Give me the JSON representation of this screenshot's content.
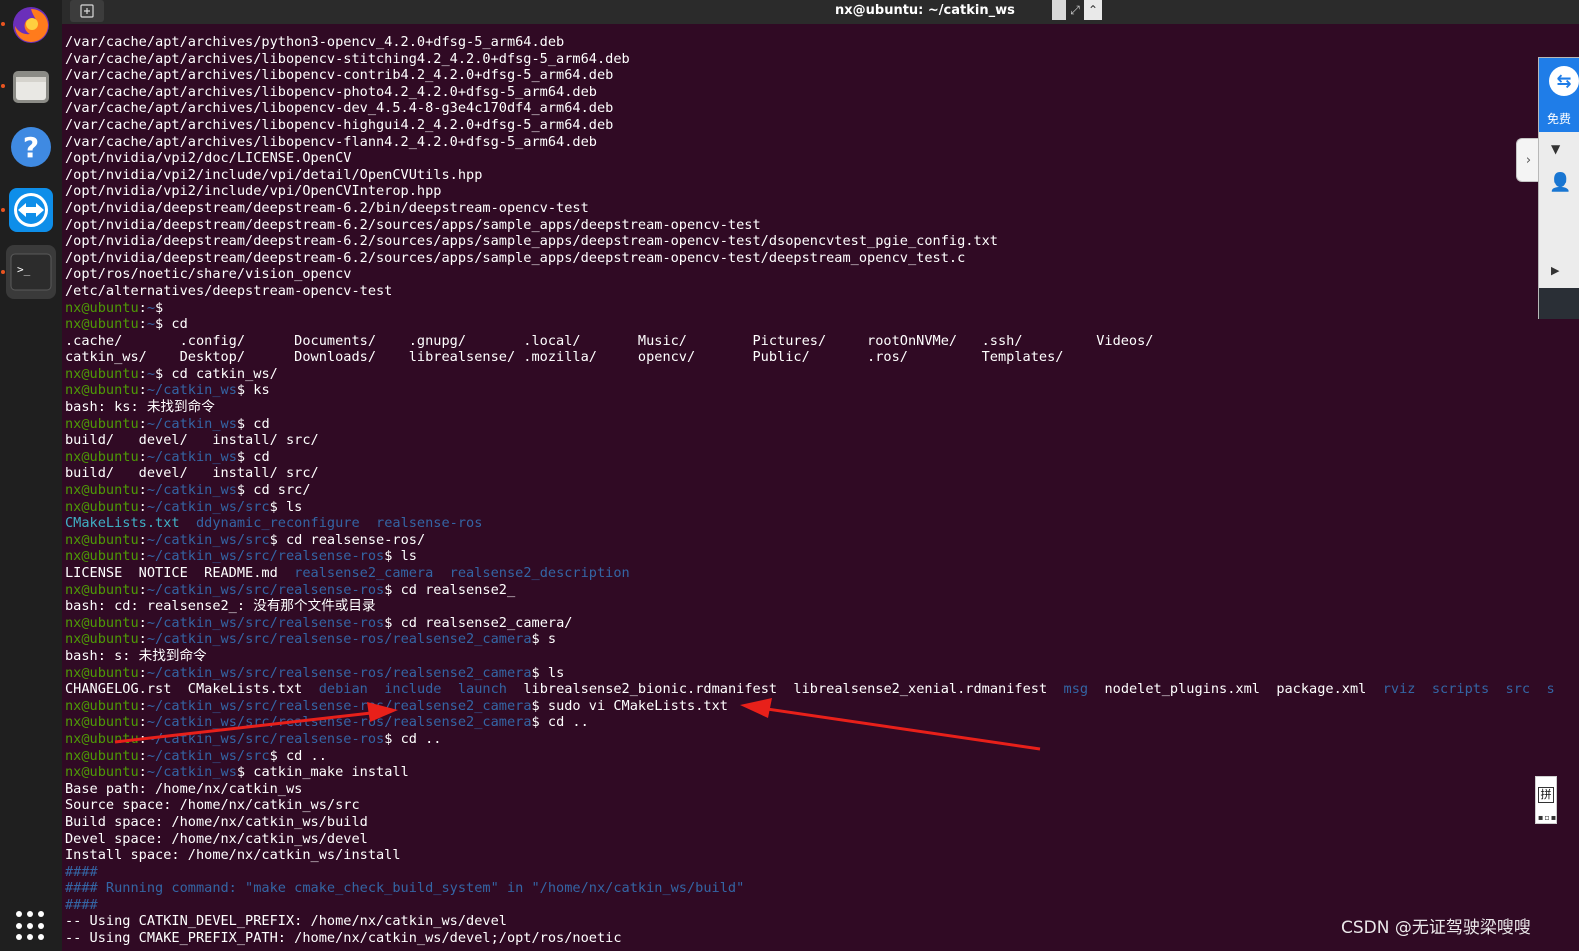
{
  "window": {
    "title": "nx@ubuntu: ~/catkin_ws",
    "new_tab_icon": "plus-square-icon"
  },
  "dock": {
    "items": [
      {
        "name": "firefox",
        "icon": "firefox-icon",
        "running": true
      },
      {
        "name": "files",
        "icon": "folder-icon",
        "running": true
      },
      {
        "name": "help",
        "icon": "help-icon",
        "glyph": "?",
        "running": false
      },
      {
        "name": "teamviewer",
        "icon": "teamviewer-icon",
        "running": true
      },
      {
        "name": "terminal",
        "icon": "terminal-icon",
        "glyph": ">_",
        "running": true
      }
    ],
    "show_apps_icon": "apps-grid-icon"
  },
  "terminal": {
    "colors": {
      "background": "#300a24",
      "prompt_user": "#4e9a06",
      "prompt_path": "#3465a4",
      "text": "#ffffff"
    },
    "lines": [
      [
        {
          "t": "/var/cache/apt/archives/python3-opencv_4.2.0+dfsg-5_arm64.deb"
        }
      ],
      [
        {
          "t": "/var/cache/apt/archives/libopencv-stitching4.2_4.2.0+dfsg-5_arm64.deb"
        }
      ],
      [
        {
          "t": "/var/cache/apt/archives/libopencv-contrib4.2_4.2.0+dfsg-5_arm64.deb"
        }
      ],
      [
        {
          "t": "/var/cache/apt/archives/libopencv-photo4.2_4.2.0+dfsg-5_arm64.deb"
        }
      ],
      [
        {
          "t": "/var/cache/apt/archives/libopencv-dev_4.5.4-8-g3e4c170df4_arm64.deb"
        }
      ],
      [
        {
          "t": "/var/cache/apt/archives/libopencv-highgui4.2_4.2.0+dfsg-5_arm64.deb"
        }
      ],
      [
        {
          "t": "/var/cache/apt/archives/libopencv-flann4.2_4.2.0+dfsg-5_arm64.deb"
        }
      ],
      [
        {
          "t": "/opt/nvidia/vpi2/doc/LICENSE.OpenCV"
        }
      ],
      [
        {
          "t": "/opt/nvidia/vpi2/include/vpi/detail/OpenCVUtils.hpp"
        }
      ],
      [
        {
          "t": "/opt/nvidia/vpi2/include/vpi/OpenCVInterop.hpp"
        }
      ],
      [
        {
          "t": "/opt/nvidia/deepstream/deepstream-6.2/bin/deepstream-opencv-test"
        }
      ],
      [
        {
          "t": "/opt/nvidia/deepstream/deepstream-6.2/sources/apps/sample_apps/deepstream-opencv-test"
        }
      ],
      [
        {
          "t": "/opt/nvidia/deepstream/deepstream-6.2/sources/apps/sample_apps/deepstream-opencv-test/dsopencvtest_pgie_config.txt"
        }
      ],
      [
        {
          "t": "/opt/nvidia/deepstream/deepstream-6.2/sources/apps/sample_apps/deepstream-opencv-test/deepstream_opencv_test.c"
        }
      ],
      [
        {
          "t": "/opt/ros/noetic/share/vision_opencv"
        }
      ],
      [
        {
          "t": "/etc/alternatives/deepstream-opencv-test"
        }
      ],
      [
        {
          "t": "nx@ubuntu",
          "c": "g"
        },
        {
          "t": ":"
        },
        {
          "t": "~",
          "c": "b"
        },
        {
          "t": "$"
        }
      ],
      [
        {
          "t": "nx@ubuntu",
          "c": "g"
        },
        {
          "t": ":"
        },
        {
          "t": "~",
          "c": "b"
        },
        {
          "t": "$ cd"
        }
      ],
      [
        {
          "t": ".cache/       .config/      Documents/    .gnupg/       .local/       Music/        Pictures/     rootOnNVMe/   .ssh/         Videos/"
        }
      ],
      [
        {
          "t": "catkin_ws/    Desktop/      Downloads/    librealsense/ .mozilla/     opencv/       Public/       .ros/         Templates/"
        }
      ],
      [
        {
          "t": "nx@ubuntu",
          "c": "g"
        },
        {
          "t": ":"
        },
        {
          "t": "~",
          "c": "b"
        },
        {
          "t": "$ cd catkin_ws/"
        }
      ],
      [
        {
          "t": "nx@ubuntu",
          "c": "g"
        },
        {
          "t": ":"
        },
        {
          "t": "~/catkin_ws",
          "c": "b"
        },
        {
          "t": "$ ks"
        }
      ],
      [
        {
          "t": "bash: ks: 未找到命令"
        }
      ],
      [
        {
          "t": "nx@ubuntu",
          "c": "g"
        },
        {
          "t": ":"
        },
        {
          "t": "~/catkin_ws",
          "c": "b"
        },
        {
          "t": "$ cd"
        }
      ],
      [
        {
          "t": "build/   devel/   install/ src/"
        }
      ],
      [
        {
          "t": "nx@ubuntu",
          "c": "g"
        },
        {
          "t": ":"
        },
        {
          "t": "~/catkin_ws",
          "c": "b"
        },
        {
          "t": "$ cd"
        }
      ],
      [
        {
          "t": "build/   devel/   install/ src/"
        }
      ],
      [
        {
          "t": "nx@ubuntu",
          "c": "g"
        },
        {
          "t": ":"
        },
        {
          "t": "~/catkin_ws",
          "c": "b"
        },
        {
          "t": "$ cd src/"
        }
      ],
      [
        {
          "t": "nx@ubuntu",
          "c": "g"
        },
        {
          "t": ":"
        },
        {
          "t": "~/catkin_ws/src",
          "c": "b"
        },
        {
          "t": "$ ls"
        }
      ],
      [
        {
          "t": "CMakeLists.txt",
          "c": "c"
        },
        {
          "t": "  "
        },
        {
          "t": "ddynamic_reconfigure",
          "c": "b"
        },
        {
          "t": "  "
        },
        {
          "t": "realsense-ros",
          "c": "b"
        }
      ],
      [
        {
          "t": "nx@ubuntu",
          "c": "g"
        },
        {
          "t": ":"
        },
        {
          "t": "~/catkin_ws/src",
          "c": "b"
        },
        {
          "t": "$ cd realsense-ros/"
        }
      ],
      [
        {
          "t": "nx@ubuntu",
          "c": "g"
        },
        {
          "t": ":"
        },
        {
          "t": "~/catkin_ws/src/realsense-ros",
          "c": "b"
        },
        {
          "t": "$ ls"
        }
      ],
      [
        {
          "t": "LICENSE  NOTICE  README.md  "
        },
        {
          "t": "realsense2_camera",
          "c": "b"
        },
        {
          "t": "  "
        },
        {
          "t": "realsense2_description",
          "c": "b"
        }
      ],
      [
        {
          "t": "nx@ubuntu",
          "c": "g"
        },
        {
          "t": ":"
        },
        {
          "t": "~/catkin_ws/src/realsense-ros",
          "c": "b"
        },
        {
          "t": "$ cd realsense2_"
        }
      ],
      [
        {
          "t": "bash: cd: realsense2_: 没有那个文件或目录"
        }
      ],
      [
        {
          "t": "nx@ubuntu",
          "c": "g"
        },
        {
          "t": ":"
        },
        {
          "t": "~/catkin_ws/src/realsense-ros",
          "c": "b"
        },
        {
          "t": "$ cd realsense2_camera/"
        }
      ],
      [
        {
          "t": "nx@ubuntu",
          "c": "g"
        },
        {
          "t": ":"
        },
        {
          "t": "~/catkin_ws/src/realsense-ros/realsense2_camera",
          "c": "b"
        },
        {
          "t": "$ s"
        }
      ],
      [
        {
          "t": "bash: s: 未找到命令"
        }
      ],
      [
        {
          "t": "nx@ubuntu",
          "c": "g"
        },
        {
          "t": ":"
        },
        {
          "t": "~/catkin_ws/src/realsense-ros/realsense2_camera",
          "c": "b"
        },
        {
          "t": "$ ls"
        }
      ],
      [
        {
          "t": "CHANGELOG.rst  CMakeLists.txt  "
        },
        {
          "t": "debian",
          "c": "b"
        },
        {
          "t": "  "
        },
        {
          "t": "include",
          "c": "b"
        },
        {
          "t": "  "
        },
        {
          "t": "launch",
          "c": "b"
        },
        {
          "t": "  librealsense2_bionic.rdmanifest  librealsense2_xenial.rdmanifest  "
        },
        {
          "t": "msg",
          "c": "b"
        },
        {
          "t": "  nodelet_plugins.xml  package.xml  "
        },
        {
          "t": "rviz",
          "c": "b"
        },
        {
          "t": "  "
        },
        {
          "t": "scripts",
          "c": "b"
        },
        {
          "t": "  "
        },
        {
          "t": "src",
          "c": "b"
        },
        {
          "t": "  "
        },
        {
          "t": "s",
          "c": "b"
        }
      ],
      [
        {
          "t": "nx@ubuntu",
          "c": "g"
        },
        {
          "t": ":"
        },
        {
          "t": "~/catkin_ws/src/realsense-ros/realsense2_camera",
          "c": "b"
        },
        {
          "t": "$ sudo vi CMakeLists.txt"
        }
      ],
      [
        {
          "t": "nx@ubuntu",
          "c": "g"
        },
        {
          "t": ":"
        },
        {
          "t": "~/catkin_ws/src/realsense-ros/realsense2_camera",
          "c": "b"
        },
        {
          "t": "$ cd .."
        }
      ],
      [
        {
          "t": "nx@ubuntu",
          "c": "g"
        },
        {
          "t": ":"
        },
        {
          "t": "~/catkin_ws/src/realsense-ros",
          "c": "b"
        },
        {
          "t": "$ cd .."
        }
      ],
      [
        {
          "t": "nx@ubuntu",
          "c": "g"
        },
        {
          "t": ":"
        },
        {
          "t": "~/catkin_ws/src",
          "c": "b"
        },
        {
          "t": "$ cd .."
        }
      ],
      [
        {
          "t": "nx@ubuntu",
          "c": "g"
        },
        {
          "t": ":"
        },
        {
          "t": "~/catkin_ws",
          "c": "b"
        },
        {
          "t": "$ catkin_make install"
        }
      ],
      [
        {
          "t": "Base path: /home/nx/catkin_ws"
        }
      ],
      [
        {
          "t": "Source space: /home/nx/catkin_ws/src"
        }
      ],
      [
        {
          "t": "Build space: /home/nx/catkin_ws/build"
        }
      ],
      [
        {
          "t": "Devel space: /home/nx/catkin_ws/devel"
        }
      ],
      [
        {
          "t": "Install space: /home/nx/catkin_ws/install"
        }
      ],
      [
        {
          "t": "####",
          "c": "b"
        }
      ],
      [
        {
          "t": "#### Running command: \"make cmake_check_build_system\" in \"/home/nx/catkin_ws/build\"",
          "c": "b"
        }
      ],
      [
        {
          "t": "####",
          "c": "b"
        }
      ],
      [
        {
          "t": "-- Using CATKIN_DEVEL_PREFIX: /home/nx/catkin_ws/devel"
        }
      ],
      [
        {
          "t": "-- Using CMAKE_PREFIX_PATH: /home/nx/catkin_ws/devel;/opt/ros/noetic"
        }
      ]
    ]
  },
  "teamviewer_panel": {
    "label": "免费",
    "icon": "teamviewer-icon",
    "collapse_icon": "chevron-right-icon",
    "dropdown_icon": "caret-down-icon",
    "user_icon": "user-icon",
    "play_icon": "play-icon"
  },
  "ime": {
    "label": "拼",
    "icon": "keyboard-icon"
  },
  "annotations": {
    "arrow_color": "#e8201a"
  },
  "watermark": "CSDN @无证驾驶梁嗖嗖"
}
